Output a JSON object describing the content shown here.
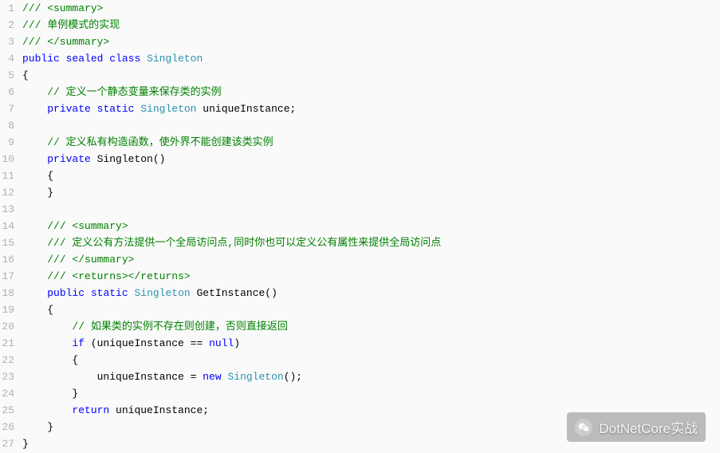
{
  "code": {
    "lines": [
      {
        "n": 1,
        "indent": 0,
        "tokens": [
          [
            "cmt",
            "/// <summary>"
          ]
        ]
      },
      {
        "n": 2,
        "indent": 0,
        "tokens": [
          [
            "cmt",
            "/// 单例模式的实现"
          ]
        ]
      },
      {
        "n": 3,
        "indent": 0,
        "tokens": [
          [
            "cmt",
            "/// </summary>"
          ]
        ]
      },
      {
        "n": 4,
        "indent": 0,
        "tokens": [
          [
            "kw",
            "public"
          ],
          [
            "text",
            " "
          ],
          [
            "kw",
            "sealed"
          ],
          [
            "text",
            " "
          ],
          [
            "kw",
            "class"
          ],
          [
            "text",
            " "
          ],
          [
            "type",
            "Singleton"
          ]
        ]
      },
      {
        "n": 5,
        "indent": 0,
        "tokens": [
          [
            "text",
            "{"
          ]
        ]
      },
      {
        "n": 6,
        "indent": 1,
        "tokens": [
          [
            "cmt",
            "// 定义一个静态变量来保存类的实例"
          ]
        ]
      },
      {
        "n": 7,
        "indent": 1,
        "tokens": [
          [
            "kw",
            "private"
          ],
          [
            "text",
            " "
          ],
          [
            "kw",
            "static"
          ],
          [
            "text",
            " "
          ],
          [
            "type",
            "Singleton"
          ],
          [
            "text",
            " uniqueInstance;"
          ]
        ]
      },
      {
        "n": 8,
        "indent": 0,
        "tokens": []
      },
      {
        "n": 9,
        "indent": 1,
        "tokens": [
          [
            "cmt",
            "// 定义私有构造函数，使外界不能创建该类实例"
          ]
        ]
      },
      {
        "n": 10,
        "indent": 1,
        "tokens": [
          [
            "kw",
            "private"
          ],
          [
            "text",
            " Singleton()"
          ]
        ]
      },
      {
        "n": 11,
        "indent": 1,
        "tokens": [
          [
            "text",
            "{"
          ]
        ]
      },
      {
        "n": 12,
        "indent": 1,
        "tokens": [
          [
            "text",
            "}"
          ]
        ]
      },
      {
        "n": 13,
        "indent": 0,
        "tokens": []
      },
      {
        "n": 14,
        "indent": 1,
        "tokens": [
          [
            "cmt",
            "/// <summary>"
          ]
        ]
      },
      {
        "n": 15,
        "indent": 1,
        "tokens": [
          [
            "cmt",
            "/// 定义公有方法提供一个全局访问点,同时你也可以定义公有属性来提供全局访问点"
          ]
        ]
      },
      {
        "n": 16,
        "indent": 1,
        "tokens": [
          [
            "cmt",
            "/// </summary>"
          ]
        ]
      },
      {
        "n": 17,
        "indent": 1,
        "tokens": [
          [
            "cmt",
            "/// <returns></returns>"
          ]
        ]
      },
      {
        "n": 18,
        "indent": 1,
        "tokens": [
          [
            "kw",
            "public"
          ],
          [
            "text",
            " "
          ],
          [
            "kw",
            "static"
          ],
          [
            "text",
            " "
          ],
          [
            "type",
            "Singleton"
          ],
          [
            "text",
            " GetInstance()"
          ]
        ]
      },
      {
        "n": 19,
        "indent": 1,
        "tokens": [
          [
            "text",
            "{"
          ]
        ]
      },
      {
        "n": 20,
        "indent": 2,
        "tokens": [
          [
            "cmt",
            "// 如果类的实例不存在则创建，否则直接返回"
          ]
        ]
      },
      {
        "n": 21,
        "indent": 2,
        "tokens": [
          [
            "kw",
            "if"
          ],
          [
            "text",
            " (uniqueInstance == "
          ],
          [
            "kw",
            "null"
          ],
          [
            "text",
            ")"
          ]
        ]
      },
      {
        "n": 22,
        "indent": 2,
        "tokens": [
          [
            "text",
            "{"
          ]
        ]
      },
      {
        "n": 23,
        "indent": 3,
        "tokens": [
          [
            "text",
            "uniqueInstance = "
          ],
          [
            "kw",
            "new"
          ],
          [
            "text",
            " "
          ],
          [
            "type",
            "Singleton"
          ],
          [
            "text",
            "();"
          ]
        ]
      },
      {
        "n": 24,
        "indent": 2,
        "tokens": [
          [
            "text",
            "}"
          ]
        ]
      },
      {
        "n": 25,
        "indent": 2,
        "tokens": [
          [
            "kw",
            "return"
          ],
          [
            "text",
            " uniqueInstance;"
          ]
        ]
      },
      {
        "n": 26,
        "indent": 1,
        "tokens": [
          [
            "text",
            "}"
          ]
        ]
      },
      {
        "n": 27,
        "indent": 0,
        "tokens": [
          [
            "text",
            "}"
          ]
        ]
      }
    ]
  },
  "watermark": {
    "label": "DotNetCore实战"
  }
}
